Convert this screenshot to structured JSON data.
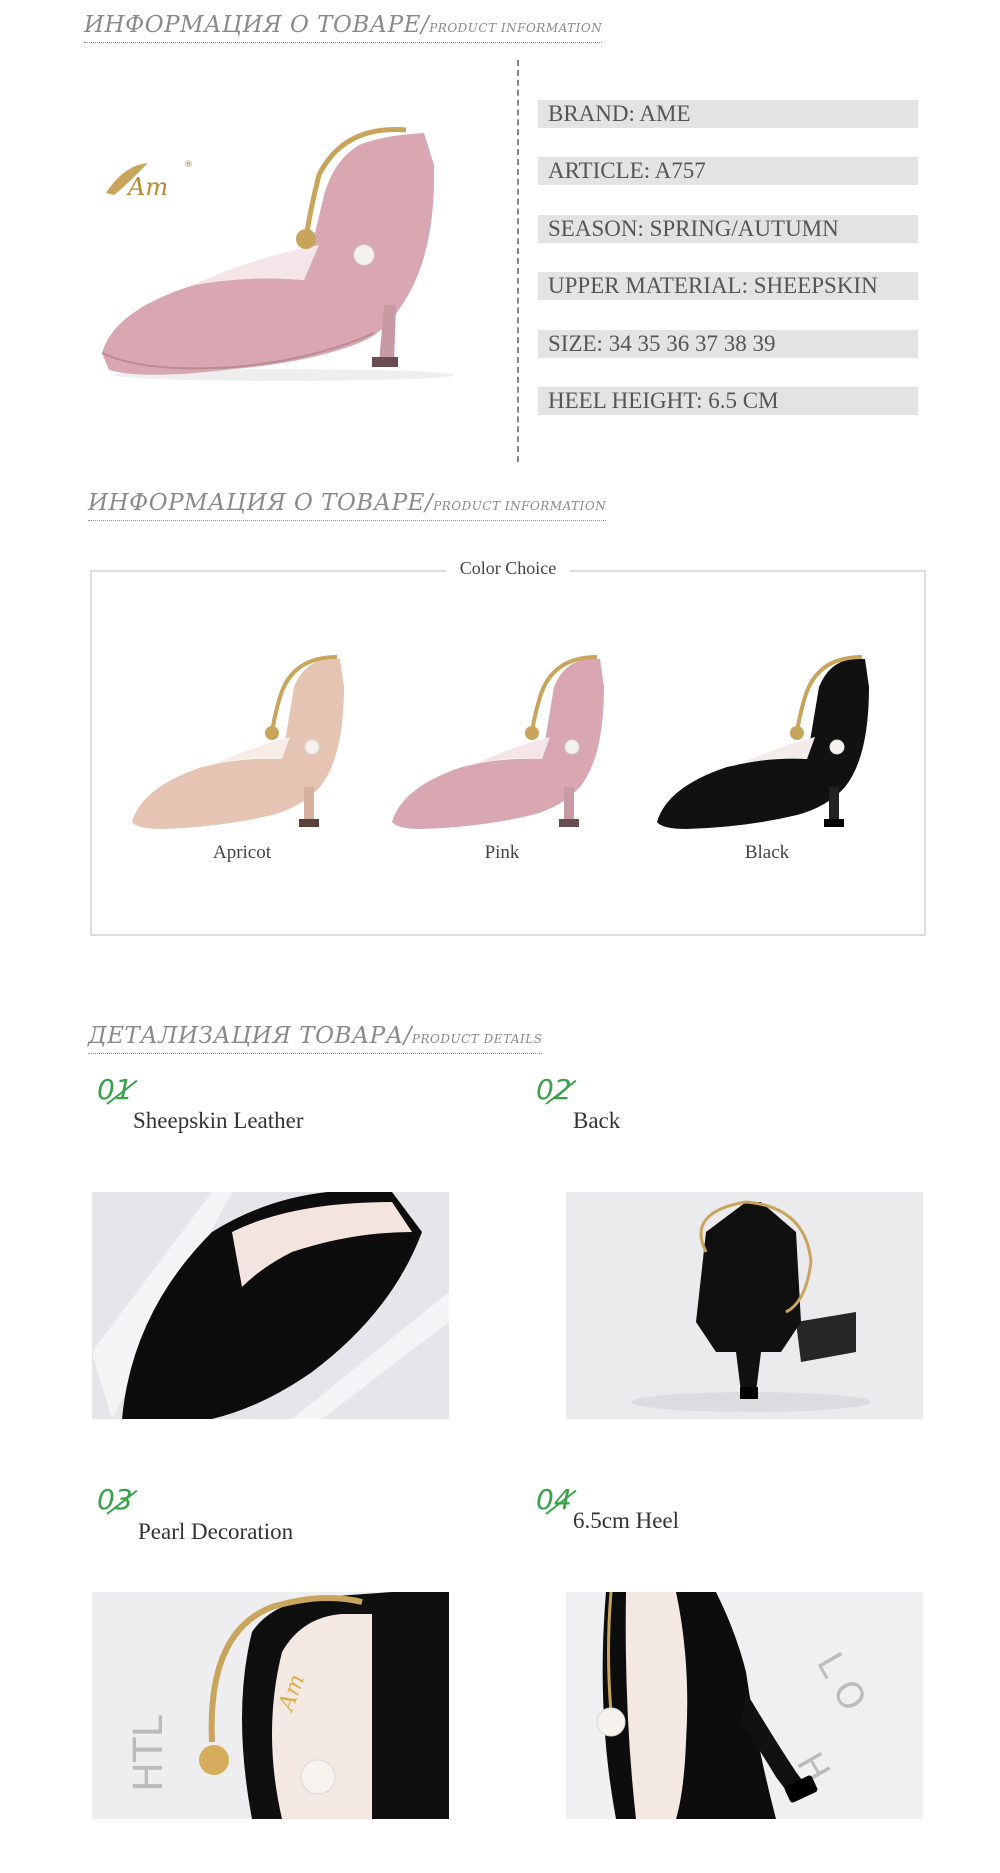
{
  "section1": {
    "title_ru": "ИНФОРМАЦИЯ О ТОВАРЕ/",
    "title_en": "Product information"
  },
  "hero": {
    "logo_text": "Am",
    "logo_mark": "®"
  },
  "specs": [
    "BRAND:  AME",
    "ARTICLE:  A757",
    "SEASON:  SPRING/AUTUMN",
    "UPPER MATERIAL: SHEEPSKIN",
    "SIZE:  34 35 36 37 38 39",
    "HEEL HEIGHT: 6.5 CM"
  ],
  "section2": {
    "title_ru": "ИНФОРМАЦИЯ О ТОВАРЕ/",
    "title_en": "Product information"
  },
  "color_choice": {
    "title": "Color Choice",
    "colors": [
      {
        "label": "Apricot",
        "color": "#e6c4b3"
      },
      {
        "label": "Pink",
        "color": "#d9a7b1"
      },
      {
        "label": "Black",
        "color": "#111111"
      }
    ]
  },
  "section3": {
    "title_ru": "ДЕТАЛИЗАЦИЯ ТОВАРА/",
    "title_en": "Product details"
  },
  "details": [
    {
      "num": "01",
      "label": "Sheepskin Leather"
    },
    {
      "num": "02",
      "label": "Back"
    },
    {
      "num": "03",
      "label": "Pearl Decoration"
    },
    {
      "num": "04",
      "label": "6.5cm Heel"
    }
  ],
  "colors": {
    "accent_green": "#3aa24a",
    "spec_bg": "#e3e3e3",
    "gold": "#c9a45c"
  }
}
